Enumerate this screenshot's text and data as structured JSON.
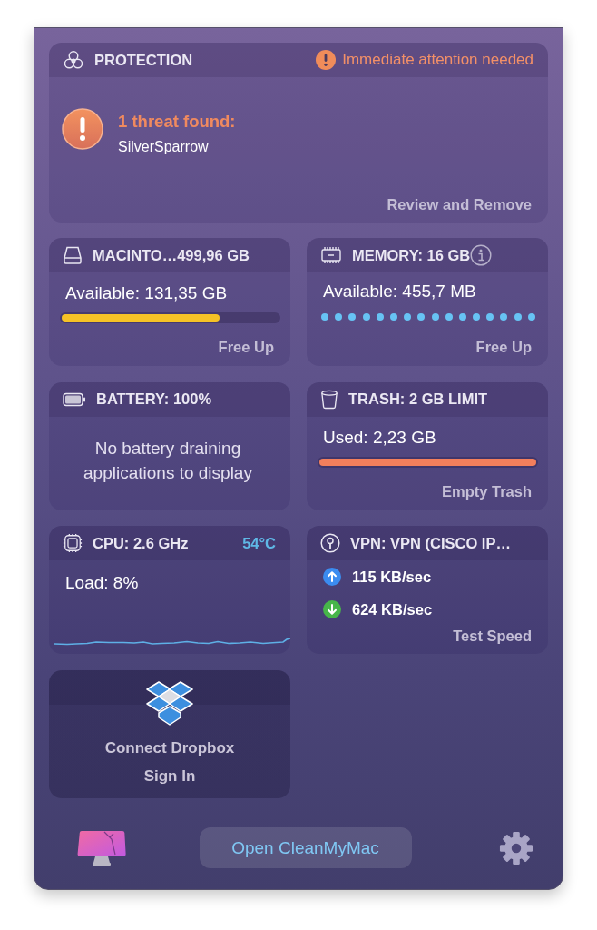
{
  "protection": {
    "title": "PROTECTION",
    "alert": "Immediate attention needed",
    "threat_title": "1 threat found:",
    "threat_name": "SilverSparrow",
    "action": "Review and Remove"
  },
  "widgets": [
    {
      "kind": "disk",
      "title": "MACINTO…499,96 GB",
      "reading": "Available: 131,35 GB",
      "level": 0.73,
      "action": "Free Up"
    },
    {
      "kind": "memory",
      "title": "MEMORY: 16 GB",
      "reading": "Available: 455,7 MB",
      "action": "Free Up"
    },
    {
      "kind": "battery",
      "title": "BATTERY: 100%",
      "message": "No battery draining applications to display"
    },
    {
      "kind": "trash",
      "title": "TRASH: 2 GB LIMIT",
      "reading": "Used: 2,23 GB",
      "level": 1,
      "action": "Empty Trash"
    },
    {
      "kind": "cpu",
      "title": "CPU: 2.6 GHz",
      "temperature": "54°C",
      "reading": "Load: 8%"
    },
    {
      "kind": "vpn",
      "title": "VPN: VPN (CISCO IP…",
      "upload": "115 KB/sec",
      "download": "624 KB/sec",
      "action": "Test Speed"
    },
    {
      "kind": "dropbox",
      "title": "Connect Dropbox",
      "action": "Sign In"
    }
  ],
  "footer": {
    "button": "Open CleanMyMac"
  }
}
